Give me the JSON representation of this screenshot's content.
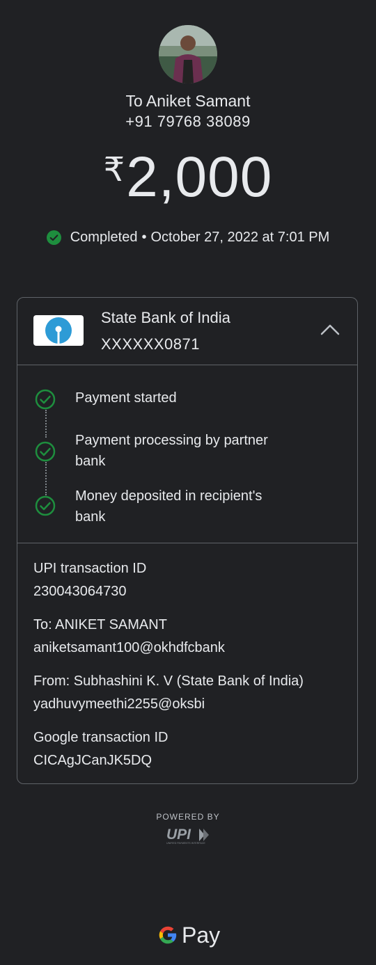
{
  "recipient": {
    "name_line": "To Aniket Samant",
    "phone": "+91 79768 38089"
  },
  "amount": {
    "currency_symbol": "₹",
    "value": "2,000"
  },
  "status": {
    "icon": "check-circle-icon",
    "text": "Completed",
    "separator": "•",
    "datetime": "October 27, 2022 at 7:01 PM",
    "color": "#1e8e3e"
  },
  "bank": {
    "name": "State Bank of India",
    "account": "XXXXXX0871",
    "logo_color": "#2d9bd6"
  },
  "timeline": [
    {
      "line1": "Payment started",
      "line2": ""
    },
    {
      "line1": "Payment processing by partner",
      "line2": "bank"
    },
    {
      "line1": "Money deposited in recipient's",
      "line2": "bank"
    }
  ],
  "details": {
    "upi_label": "UPI transaction ID",
    "upi_value": "230043064730",
    "to_label": "To: ANIKET SAMANT",
    "to_value": "aniketsamant100@okhdfcbank",
    "from_label": "From: Subhashini K. V (State Bank of India)",
    "from_value": "yadhuvymeethi2255@oksbi",
    "google_label": "Google transaction ID",
    "google_value": "CICAgJCanJK5DQ"
  },
  "footer": {
    "powered_by": "POWERED BY",
    "upi_logo_text": "UPI",
    "upi_logo_subtext": "UNIFIED PAYMENTS INTERFACE",
    "brand_letter": "G",
    "brand_text": "Pay"
  }
}
